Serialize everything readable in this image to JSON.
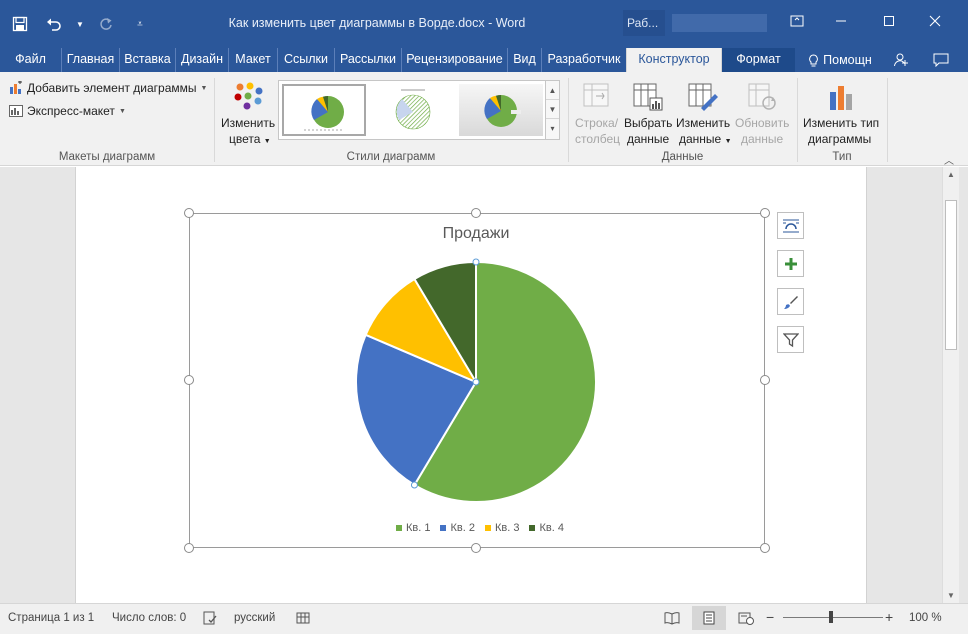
{
  "window": {
    "title": "Как изменить цвет диаграммы в Ворде.docx - Word",
    "work_tab": "Раб..."
  },
  "tabs": [
    {
      "label": "Файл"
    },
    {
      "label": "Главная"
    },
    {
      "label": "Вставка"
    },
    {
      "label": "Дизайн"
    },
    {
      "label": "Макет"
    },
    {
      "label": "Ссылки"
    },
    {
      "label": "Рассылки"
    },
    {
      "label": "Рецензирование"
    },
    {
      "label": "Вид"
    },
    {
      "label": "Разработчик"
    },
    {
      "label": "Конструктор"
    },
    {
      "label": "Формат"
    }
  ],
  "help": {
    "label": "Помощн"
  },
  "ribbon": {
    "layouts": {
      "add_element": "Добавить элемент диаграммы",
      "quick_layout": "Экспресс-макет",
      "group_label": "Макеты диаграмм"
    },
    "styles": {
      "change_colors_line1": "Изменить",
      "change_colors_line2": "цвета",
      "group_label": "Стили диаграмм"
    },
    "data": {
      "switch_row_col_line1": "Строка/",
      "switch_row_col_line2": "столбец",
      "select_data_line1": "Выбрать",
      "select_data_line2": "данные",
      "edit_data_line1": "Изменить",
      "edit_data_line2": "данные",
      "refresh_data_line1": "Обновить",
      "refresh_data_line2": "данные",
      "group_label": "Данные"
    },
    "type": {
      "change_type_line1": "Изменить тип",
      "change_type_line2": "диаграммы",
      "group_label": "Тип"
    }
  },
  "colors": {
    "brand": "#2b579a",
    "kv1": "#70ad47",
    "kv2": "#4472c4",
    "kv3": "#ffc000",
    "kv4": "#43682b"
  },
  "chart_data": {
    "type": "pie",
    "title": "Продажи",
    "categories": [
      "Кв. 1",
      "Кв. 2",
      "Кв. 3",
      "Кв. 4"
    ],
    "values": [
      8.2,
      3.2,
      1.4,
      1.2
    ],
    "legend_position": "bottom"
  },
  "statusbar": {
    "page": "Страница 1 из 1",
    "words": "Число слов: 0",
    "language": "русский",
    "zoom": "100 %"
  }
}
